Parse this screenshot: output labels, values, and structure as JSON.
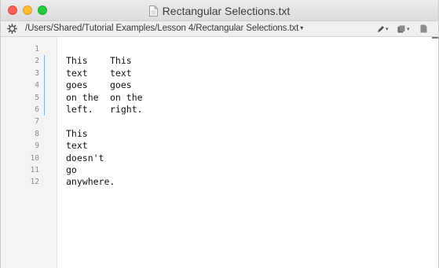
{
  "window": {
    "title": "Rectangular Selections.txt",
    "traffic_lights": [
      "close",
      "minimize",
      "zoom"
    ]
  },
  "pathbar": {
    "path": "/Users/Shared/Tutorial Examples/Lesson 4/Rectangular Selections.txt",
    "dropdown_glyph": "▾",
    "tools": [
      {
        "icon": "pen-icon",
        "caret": "▾"
      },
      {
        "icon": "bookmark-stack-icon",
        "caret": "▾"
      },
      {
        "icon": "document-icon"
      }
    ]
  },
  "gutter": {
    "line_numbers": [
      "1",
      "2",
      "3",
      "4",
      "5",
      "6",
      "7",
      "8",
      "9",
      "10",
      "11",
      "12"
    ]
  },
  "editor": {
    "lines": [
      {
        "left": "",
        "right": ""
      },
      {
        "left": "This",
        "right": "This"
      },
      {
        "left": "text",
        "right": "text"
      },
      {
        "left": "goes",
        "right": "goes"
      },
      {
        "left": "on the",
        "right": "on the"
      },
      {
        "left": "left.",
        "right": "right."
      },
      {
        "left": "",
        "right": ""
      },
      {
        "left": "This",
        "right": ""
      },
      {
        "left": "text",
        "right": ""
      },
      {
        "left": "doesn't",
        "right": ""
      },
      {
        "left": "go",
        "right": ""
      },
      {
        "left": "anywhere.",
        "right": ""
      }
    ]
  },
  "colors": {
    "close": "#fc5f57",
    "minimize": "#fdbc2e",
    "zoom": "#28c840",
    "selection_marker": "#7fb3e6",
    "gutter_bg": "#f4f4f4"
  }
}
